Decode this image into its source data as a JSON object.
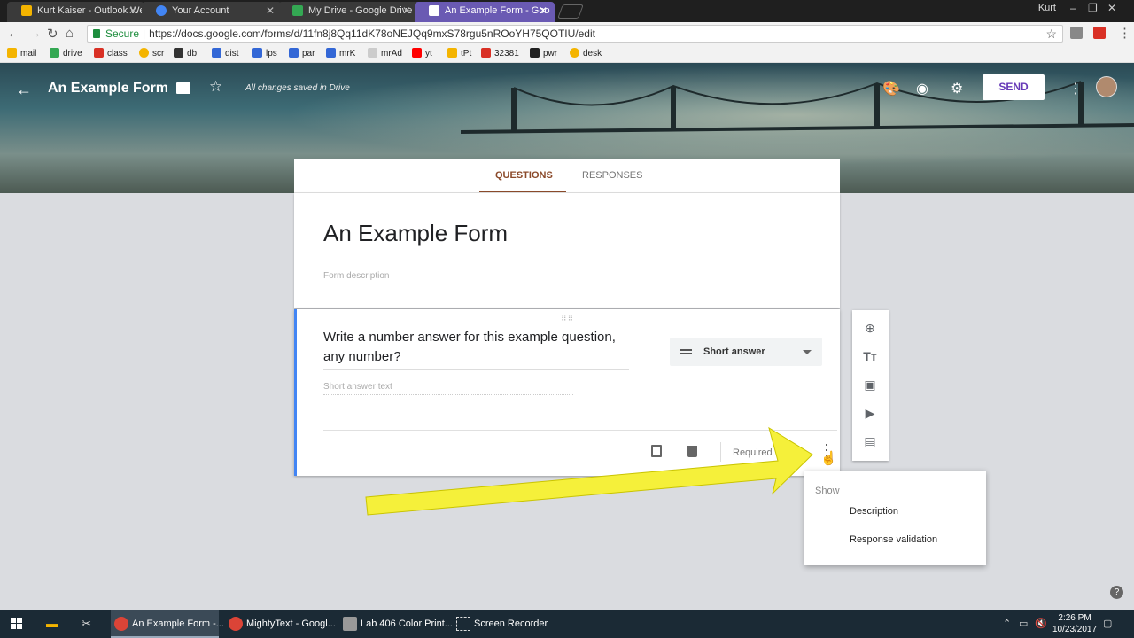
{
  "browser": {
    "tabs": [
      {
        "label": "Kurt Kaiser - Outlook We",
        "color": "#f4b400"
      },
      {
        "label": "Your Account",
        "color": "#4285f4"
      },
      {
        "label": "My Drive - Google Drive",
        "color": "#34a853"
      },
      {
        "label": "An Example Form - Goo",
        "color": "#673ab7"
      }
    ],
    "user": "Kurt",
    "secure_label": "Secure",
    "url": "https://docs.google.com/forms/d/11fn8j8Qq11dK78oNEJQq9mxS78rgu5nROoYH75QOTIU/edit",
    "bookmarks": [
      "mail",
      "drive",
      "class",
      "scr",
      "db",
      "dist",
      "lps",
      "par",
      "mrK",
      "mrAd",
      "yt",
      "tPt",
      "32381",
      "pwr",
      "desk"
    ]
  },
  "header": {
    "title": "An Example Form",
    "saved_status": "All changes saved in Drive",
    "send_label": "SEND",
    "accent": "#673ab7"
  },
  "tabs": {
    "questions": "QUESTIONS",
    "responses": "RESPONSES"
  },
  "form": {
    "title": "An Example Form",
    "description_placeholder": "Form description"
  },
  "question": {
    "text": "Write a number answer for this example question, any number?",
    "type": "Short answer",
    "answer_placeholder": "Short answer text",
    "required_label": "Required"
  },
  "menu": {
    "header": "Show",
    "items": [
      "Description",
      "Response validation"
    ]
  },
  "taskbar": {
    "items": [
      "An Example Form -...",
      "MightyText - Googl...",
      "Lab 406 Color Print...",
      "Screen Recorder"
    ],
    "time": "2:26 PM",
    "date": "10/23/2017"
  }
}
